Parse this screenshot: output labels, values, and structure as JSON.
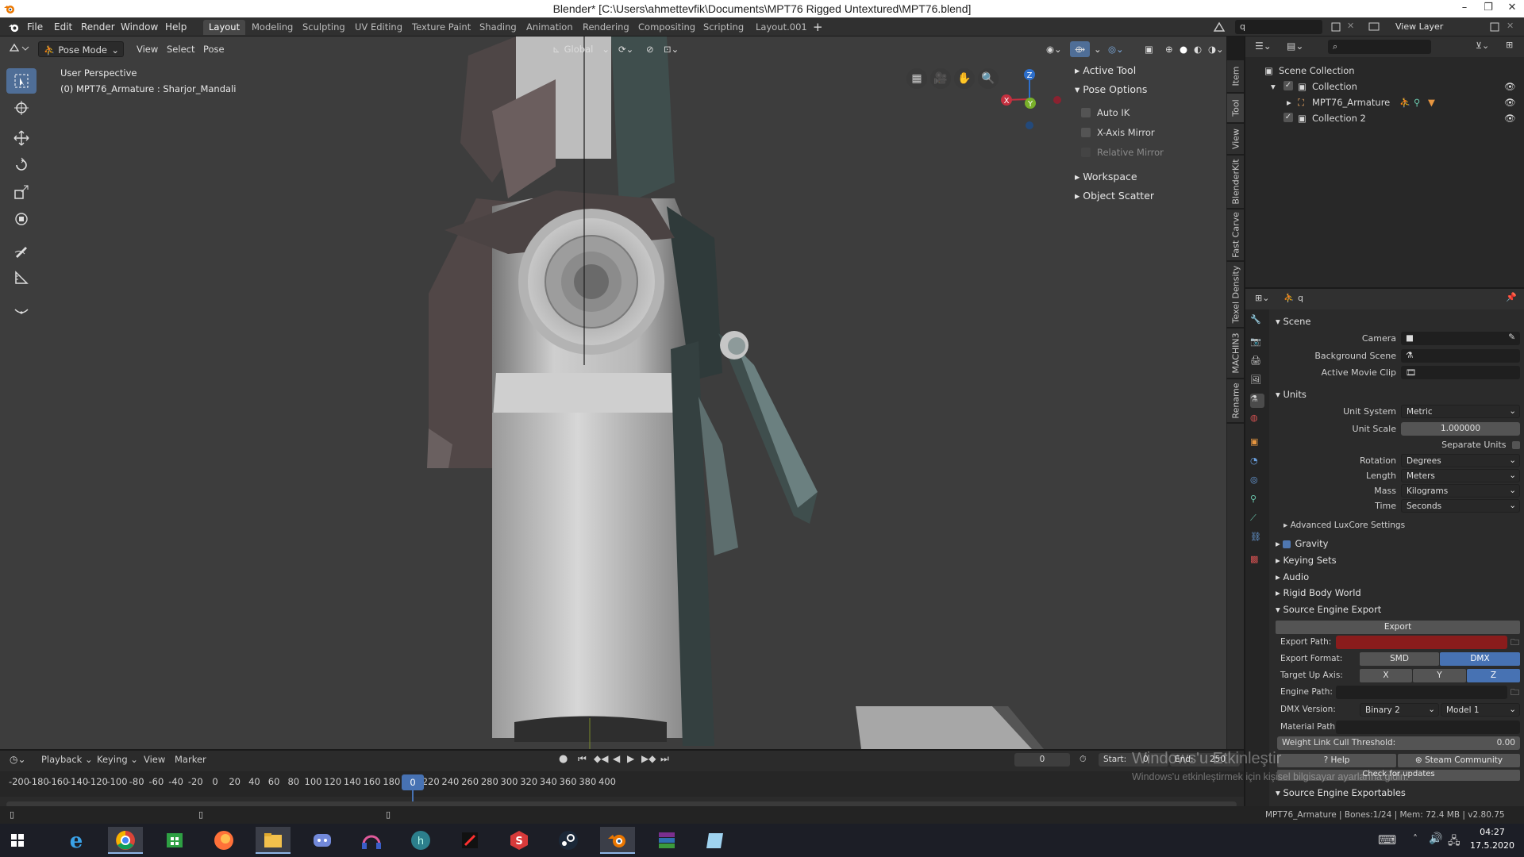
{
  "window": {
    "title": "Blender* [C:\\Users\\ahmettevfik\\Documents\\MPT76 Rigged Untextured\\MPT76.blend]"
  },
  "menu": {
    "items": [
      "File",
      "Edit",
      "Render",
      "Window",
      "Help"
    ],
    "workspaces": [
      "Layout",
      "Modeling",
      "Sculpting",
      "UV Editing",
      "Texture Paint",
      "Shading",
      "Animation",
      "Rendering",
      "Compositing",
      "Scripting",
      "Layout.001"
    ],
    "active_workspace": "Layout",
    "scene_search": "q",
    "view_layer": "View Layer"
  },
  "viewport": {
    "mode": "Pose Mode",
    "menus": [
      "View",
      "Select",
      "Pose"
    ],
    "transform_orientation": "Global",
    "info_line1": "User Perspective",
    "info_line2": "(0) MPT76_Armature : Sharjor_Mandali",
    "gizmo": {
      "x": "X",
      "y": "Y",
      "z": "Z"
    }
  },
  "npanel": {
    "active_tool": "Active Tool",
    "pose_options": "Pose Options",
    "auto_ik": "Auto IK",
    "x_axis_mirror": "X-Axis Mirror",
    "relative_mirror": "Relative Mirror",
    "workspace": "Workspace",
    "object_scatter": "Object Scatter",
    "tabs": [
      "Item",
      "Tool",
      "View",
      "BlenderKit",
      "Fast Carve",
      "Texel Density",
      "MACHIN3",
      "Rename"
    ]
  },
  "outliner": {
    "search": "",
    "scene_collection": "Scene Collection",
    "rows": [
      {
        "label": "Collection"
      },
      {
        "label": "MPT76_Armature"
      },
      {
        "label": "Collection 2"
      }
    ]
  },
  "properties": {
    "search": "q",
    "scene_title": "Scene",
    "camera_label": "Camera",
    "background_scene_label": "Background Scene",
    "active_movie_clip_label": "Active Movie Clip",
    "units_title": "Units",
    "unit_system_label": "Unit System",
    "unit_system": "Metric",
    "unit_scale_label": "Unit Scale",
    "unit_scale": "1.000000",
    "separate_units": "Separate Units",
    "rotation_label": "Rotation",
    "rotation": "Degrees",
    "length_label": "Length",
    "length": "Meters",
    "mass_label": "Mass",
    "mass": "Kilograms",
    "time_label": "Time",
    "time": "Seconds",
    "advanced_luxcore": "Advanced LuxCore Settings",
    "gravity": "Gravity",
    "keying_sets": "Keying Sets",
    "audio": "Audio",
    "rigid_body_world": "Rigid Body World",
    "source_engine_export": "Source Engine Export",
    "export_btn": "Export",
    "export_path_label": "Export Path:",
    "export_format_label": "Export Format:",
    "format_smd": "SMD",
    "format_dmx": "DMX",
    "target_up_label": "Target Up Axis:",
    "axis_x": "X",
    "axis_y": "Y",
    "axis_z": "Z",
    "engine_path_label": "Engine Path:",
    "dmx_version_label": "DMX Version:",
    "dmx_version": "Binary 2",
    "dmx_model": "Model 1",
    "material_path_label": "Material Path:",
    "weight_link_label": "Weight Link Cull Threshold:",
    "weight_link_value": "0.00",
    "help_btn": "Help",
    "steam_btn": "Steam Community",
    "check_updates": "Check for updates",
    "source_exportables": "Source Engine Exportables"
  },
  "timeline": {
    "menus": [
      "Playback",
      "Keying",
      "View",
      "Marker"
    ],
    "current_frame": "0",
    "start_label": "Start:",
    "start": "0",
    "end_label": "End:",
    "end": "250",
    "ruler": [
      "-200",
      "-180",
      "-160",
      "-140",
      "-120",
      "-100",
      "-80",
      "-60",
      "-40",
      "-20",
      "0",
      "20",
      "40",
      "60",
      "80",
      "100",
      "120",
      "140",
      "160",
      "180",
      "200",
      "220",
      "240",
      "260",
      "280",
      "300",
      "320",
      "340",
      "360",
      "380",
      "400"
    ]
  },
  "watermark": {
    "line1": "Windows'u Etkinleştir",
    "line2": "Windows'u etkinleştirmek için kişisel bilgisayar ayarlarına gidin."
  },
  "status": {
    "text": "MPT76_Armature | Bones:1/24 | Mem: 72.4 MB | v2.80.75"
  },
  "taskbar": {
    "time": "04:27",
    "date": "17.5.2020"
  },
  "colors": {
    "accent": "#4772b3",
    "red_field": "#8a1c1c",
    "viewport_bg": "#3d3d3d"
  }
}
